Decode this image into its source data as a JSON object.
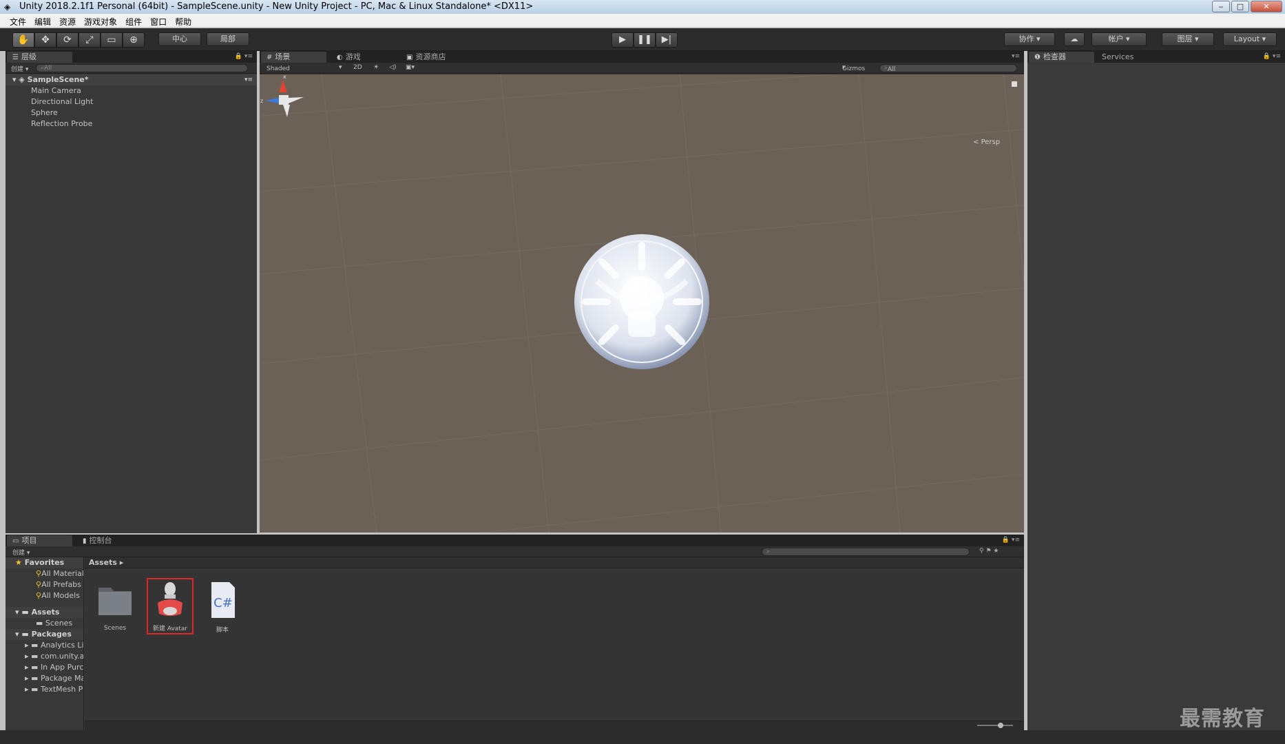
{
  "window": {
    "title": "Unity 2018.2.1f1 Personal (64bit) - SampleScene.unity - New Unity Project - PC, Mac & Linux Standalone* <DX11>",
    "min": "‒",
    "max": "□",
    "close": "✕"
  },
  "menu": [
    "文件",
    "编辑",
    "资源",
    "游戏对象",
    "组件",
    "窗口",
    "帮助"
  ],
  "toolbar": {
    "tools": [
      "✋",
      "✥",
      "⟳",
      "⤢",
      "▭",
      "⊕"
    ],
    "pivot": "中心",
    "space": "局部",
    "play": "▶",
    "pause": "❚❚",
    "step": "▶|",
    "collab": "协作",
    "cloud": "☁",
    "account": "帐户",
    "layers": "图层",
    "layout": "Layout"
  },
  "hierarchy": {
    "tab": "层级",
    "create": "创建",
    "search_placeholder": "All",
    "scene": "SampleScene*",
    "items": [
      "Main Camera",
      "Directional Light",
      "Sphere",
      "Reflection Probe"
    ]
  },
  "scene": {
    "tabs": [
      "场景",
      "游戏",
      "资源商店"
    ],
    "shading": "Shaded",
    "mode2d": "2D",
    "gizmos": "Gizmos",
    "search_placeholder": "All",
    "persp": "Persp",
    "axis_x": "x",
    "axis_z": "z"
  },
  "inspector": {
    "tabs": [
      "检查器",
      "Services"
    ]
  },
  "project": {
    "tabs": [
      "项目",
      "控制台"
    ],
    "create": "创建",
    "favorites": {
      "label": "Favorites",
      "items": [
        "All Materials",
        "All Prefabs",
        "All Models"
      ]
    },
    "assets": {
      "label": "Assets",
      "items": [
        "Scenes"
      ]
    },
    "packages": {
      "label": "Packages",
      "items": [
        "Analytics Lib",
        "com.unity.ad",
        "In App Purch",
        "Package Mar",
        "TextMesh Pr"
      ]
    },
    "path": "Assets",
    "files": [
      {
        "name": "Scenes",
        "icon": "folder-icon"
      },
      {
        "name": "新建 Avatar",
        "icon": "avatar-icon"
      },
      {
        "name": "脚本",
        "icon": "csharp-script-icon"
      }
    ]
  },
  "watermark": "最需教育",
  "colors": {
    "scene_bg": "#6b6157",
    "selection": "#e3262a",
    "panel": "#383838"
  }
}
